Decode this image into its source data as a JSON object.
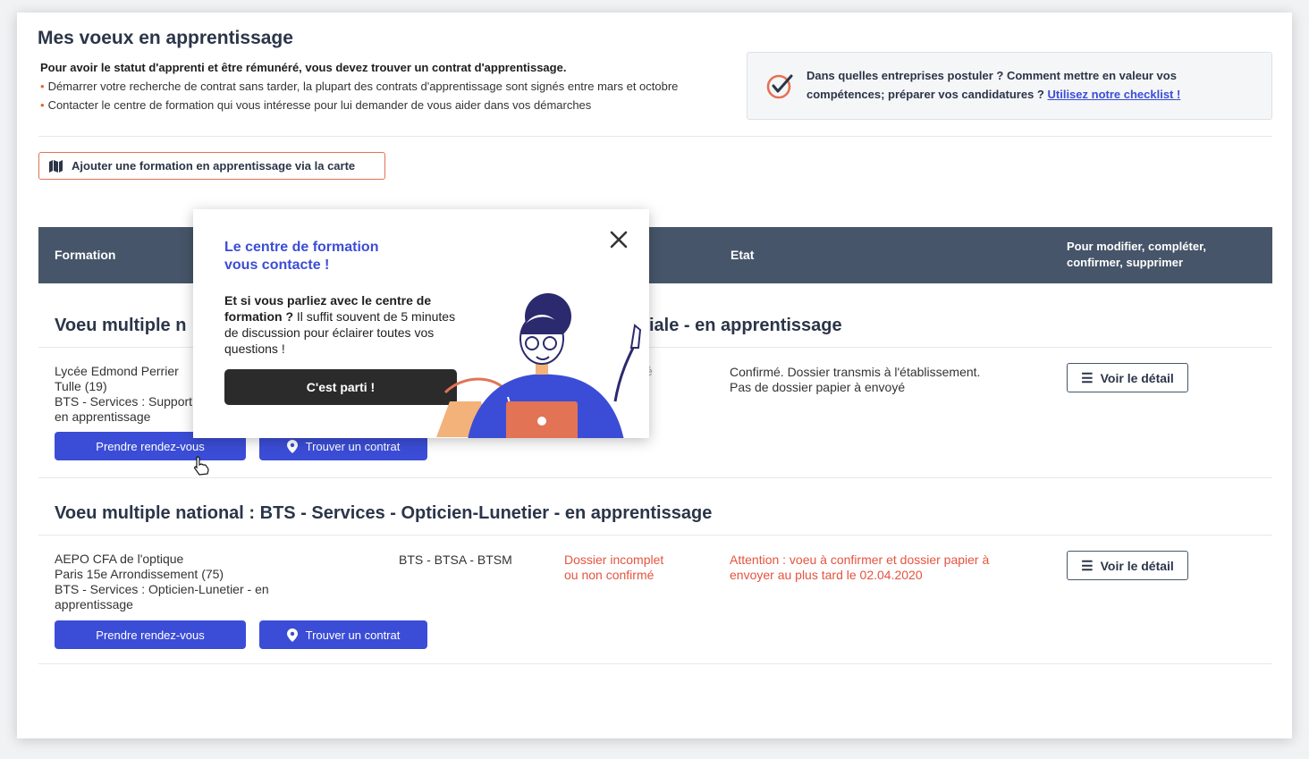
{
  "page": {
    "title": "Mes voeux en apprentissage",
    "intro": "Pour avoir le statut d'apprenti et être rémunéré, vous devez trouver un contrat d'apprentissage.",
    "bullets": [
      "Démarrer votre recherche de contrat sans tarder, la plupart des contrats d'apprentissage sont signés entre mars et octobre",
      "Contacter le centre de formation qui vous intéresse pour lui demander de vous aider dans vos démarches"
    ]
  },
  "checklist_card": {
    "text": "Dans quelles entreprises postuler ? Comment mettre en valeur vos compétences; préparer vos candidatures ?",
    "link": "Utilisez notre checklist !",
    "icon": "checklist-check-icon",
    "accent": "#e27354"
  },
  "add_button": {
    "label": "Ajouter une formation en apprentissage via la carte",
    "icon": "map-icon"
  },
  "table_header": {
    "formation": "Formation",
    "etat": "Etat",
    "actions_line1": "Pour modifier, compléter,",
    "actions_line2": "confirmer, supprimer"
  },
  "voeux": [
    {
      "title_left": "Voeu multiple n",
      "title_right": "iale - en apprentissage",
      "establishment": "Lycée Edmond Perrier",
      "city": "Tulle (19)",
      "formation_line1": "BTS - Services : Support",
      "formation_line2": "en apprentissage",
      "partial_text": "é",
      "status_line1": "Confirmé. Dossier transmis à l'établissement.",
      "status_line2": "Pas de dossier papier à envoyé",
      "detail_label": "Voir le détail",
      "rdv_label": "Prendre rendez-vous",
      "contract_label": "Trouver un contrat"
    },
    {
      "title": "Voeu multiple national : BTS - Services - Opticien-Lunetier - en apprentissage",
      "establishment": "AEPO CFA de l'optique",
      "city": "Paris 15e Arrondissement (75)",
      "formation_line1": "BTS - Services : Opticien-Lunetier - en",
      "formation_line2": "apprentissage",
      "codes": "BTS - BTSA - BTSM",
      "dossier_line1": "Dossier incomplet",
      "dossier_line2": "ou non confirmé",
      "status_line1": "Attention : voeu à confirmer et dossier papier à",
      "status_line2": "envoyer au plus tard le 02.04.2020",
      "detail_label": "Voir le détail",
      "rdv_label": "Prendre rendez-vous",
      "contract_label": "Trouver un contrat"
    }
  ],
  "popup": {
    "title_line1": "Le centre de formation",
    "title_line2": "vous contacte !",
    "body_bold": "Et si vous parliez avec le centre de formation ?",
    "body_rest": " Il suffit souvent de 5 minutes de discussion pour éclairer toutes vos questions !",
    "cta": "C'est parti !",
    "close_icon": "close-icon"
  },
  "colors": {
    "header_bg": "#465569",
    "primary_blue": "#3b4dd6",
    "warning_red": "#e4543f",
    "accent_orange": "#e27354"
  }
}
